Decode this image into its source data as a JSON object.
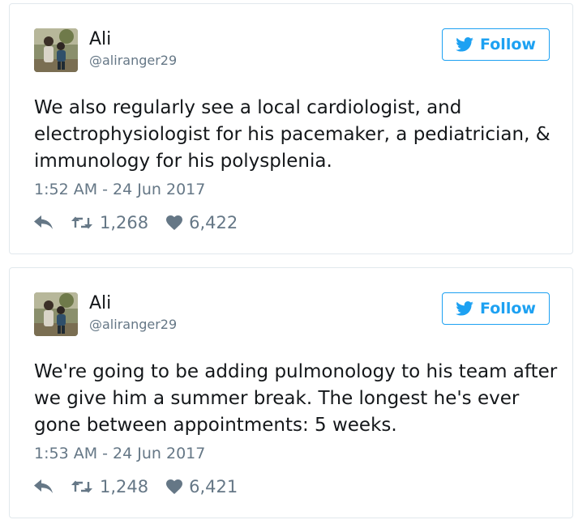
{
  "colors": {
    "accent": "#1da1f2",
    "secondary_text": "#657786",
    "primary_text": "#14171a",
    "border": "#e1e8ed"
  },
  "tweets": [
    {
      "author": {
        "name": "Ali",
        "handle": "@aliranger29",
        "avatar_icon": "avatar-photo-icon"
      },
      "follow_label": "Follow",
      "text": "We also regularly see a local cardiologist, and electrophysiologist for his pacemaker, a pediatrician, & immunology for his polysplenia.",
      "timestamp": "1:52 AM - 24 Jun 2017",
      "retweets": "1,268",
      "likes": "6,422"
    },
    {
      "author": {
        "name": "Ali",
        "handle": "@aliranger29",
        "avatar_icon": "avatar-photo-icon"
      },
      "follow_label": "Follow",
      "text": "We're going to be adding pulmonology to his team after we give him a summer break. The longest he's ever gone between appointments: 5 weeks.",
      "timestamp": "1:53 AM - 24 Jun 2017",
      "retweets": "1,248",
      "likes": "6,421"
    }
  ]
}
